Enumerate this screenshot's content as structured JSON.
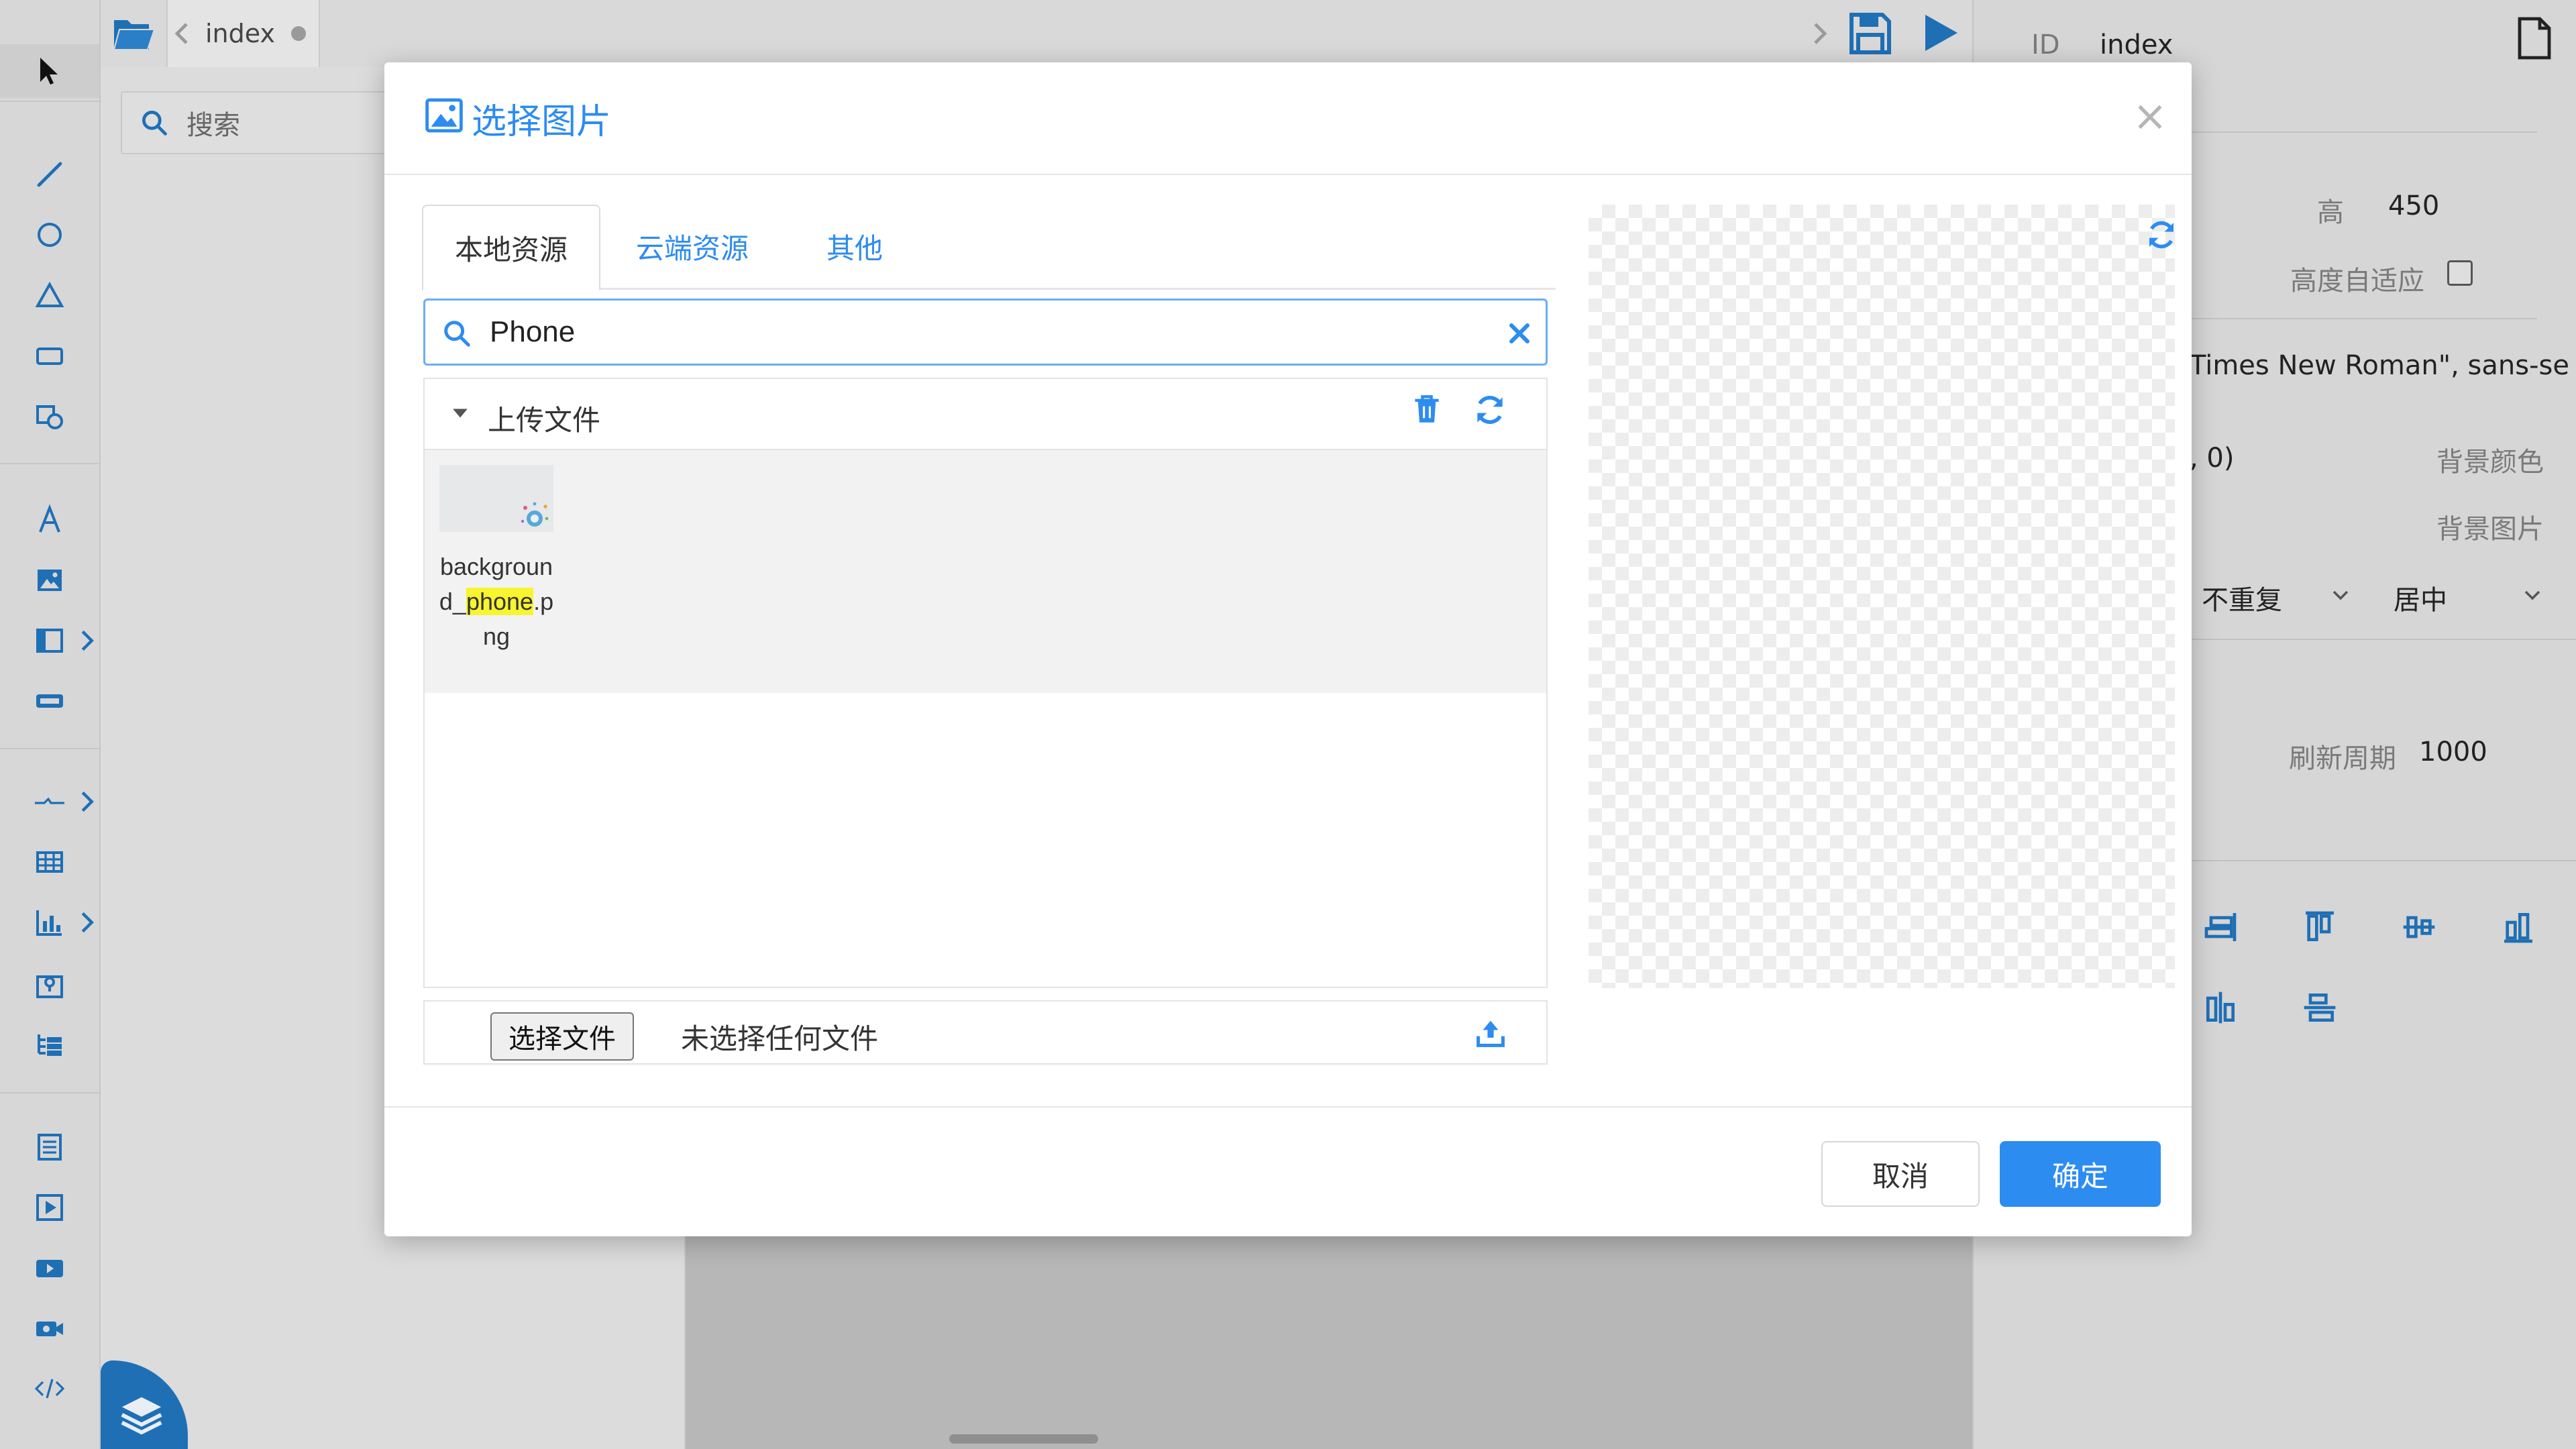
{
  "editor": {
    "tab_title": "index",
    "search_placeholder": "搜索",
    "toolbar_icons": [
      "folder-open-icon",
      "chevron-left-icon",
      "chevron-right-icon",
      "save-icon",
      "play-icon"
    ],
    "left_tools": [
      "pointer-icon",
      "line-icon",
      "circle-icon",
      "triangle-icon",
      "rectangle-icon",
      "shape-icon",
      "text-icon",
      "image-icon",
      "panel-icon",
      "button-icon",
      "connector-icon",
      "table-icon",
      "bar-chart-icon",
      "map-icon",
      "tree-icon",
      "form-icon",
      "video-play-icon",
      "video-icon",
      "camera-icon",
      "code-icon"
    ],
    "layers_icon": "layers-icon"
  },
  "props": {
    "id_label": "ID",
    "id_value": "index",
    "height_label": "高",
    "height_value": "450",
    "auto_height_label": "高度自适应",
    "auto_height_checked": false,
    "font_family_value": "Times New Roman\", sans-se",
    "color_value": ", 0)",
    "bg_color_label": "背景颜色",
    "bg_image_label": "背景图片",
    "repeat_value": "不重复",
    "position_value": "居中",
    "refresh_label": "刷新周期",
    "refresh_value": "1000"
  },
  "modal": {
    "title": "选择图片",
    "close_symbol": "×",
    "tabs": [
      {
        "label": "本地资源",
        "active": true
      },
      {
        "label": "云端资源",
        "active": false
      },
      {
        "label": "其他",
        "active": false
      }
    ],
    "search_value": "Phone",
    "folder": {
      "name": "上传文件",
      "expanded": true
    },
    "files": [
      {
        "name_before": "background_",
        "name_match": "phone",
        "name_after": ".png"
      }
    ],
    "upload": {
      "choose_label": "选择文件",
      "status": "未选择任何文件"
    },
    "buttons": {
      "cancel": "取消",
      "confirm": "确定"
    },
    "accent_color": "#2d8cf0",
    "highlight_color": "#f7f430"
  }
}
